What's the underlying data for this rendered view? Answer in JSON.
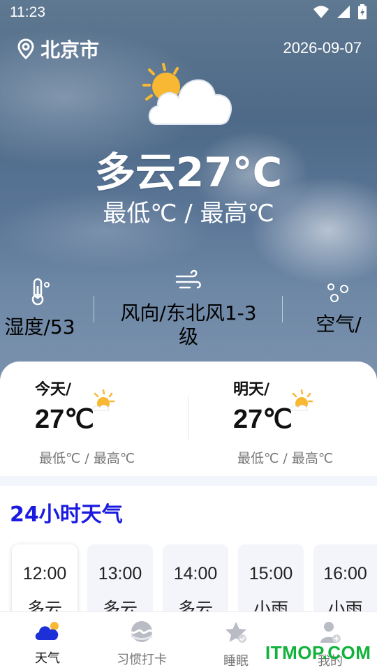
{
  "status_bar": {
    "time": "11:23"
  },
  "header": {
    "city": "北京市",
    "date": "2026-09-07"
  },
  "current": {
    "condition_temp": "多云27°C",
    "range": "最低℃  /  最高℃",
    "icon": "partly-cloudy-icon"
  },
  "stats": {
    "humidity": "湿度/53",
    "wind_line1": "风向/东北风1-3",
    "wind_line2": "级",
    "air": "空气/"
  },
  "today": {
    "label": "今天/",
    "temp": "27℃",
    "range": "最低℃ / 最高℃"
  },
  "tomorrow": {
    "label": "明天/",
    "temp": "27℃",
    "range": "最低℃ / 最高℃"
  },
  "hourly": {
    "title": "24小时天气",
    "items": [
      {
        "time": "12:00",
        "condition": "多云"
      },
      {
        "time": "13:00",
        "condition": "多云"
      },
      {
        "time": "14:00",
        "condition": "多云"
      },
      {
        "time": "15:00",
        "condition": "小雨"
      },
      {
        "time": "16:00",
        "condition": "小雨"
      }
    ]
  },
  "tabs": [
    {
      "label": "天气",
      "icon": "cloud-icon"
    },
    {
      "label": "习惯打卡",
      "icon": "habit-icon"
    },
    {
      "label": "睡眠",
      "icon": "star-icon"
    },
    {
      "label": "我的",
      "icon": "user-icon"
    }
  ],
  "watermark": "ITMOP.COM",
  "colors": {
    "accent": "#1a1ae0",
    "tab_active": "#1d2fd6",
    "sun": "#f8b833",
    "watermark": "#10b23a"
  }
}
